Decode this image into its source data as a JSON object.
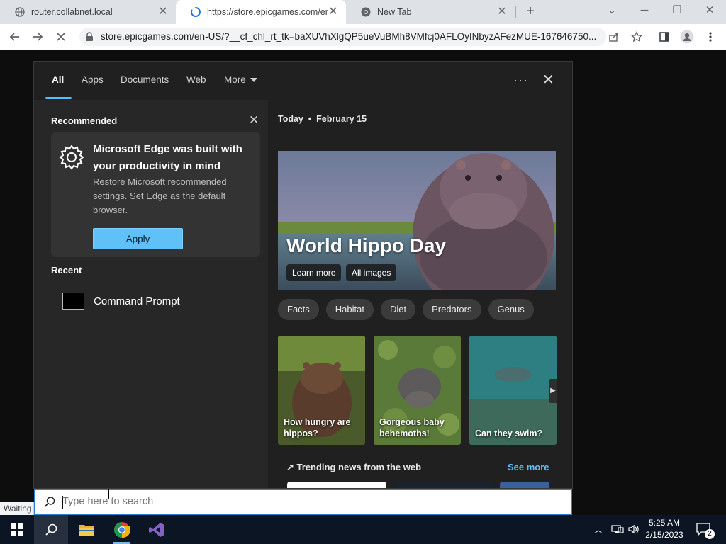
{
  "browser": {
    "tabs": [
      {
        "title": "router.collabnet.local",
        "active": false,
        "icon": "globe-icon"
      },
      {
        "title": "https://store.epicgames.com/en-",
        "active": true,
        "icon": "loading-spinner-icon"
      },
      {
        "title": "New Tab",
        "active": false,
        "icon": "chrome-icon"
      }
    ],
    "new_tab_icon": "plus-icon",
    "address_url": "store.epicgames.com/en-US/?__cf_chl_rt_tk=baXUVhXlgQP5ueVuBMh8VMfcj0AFLOyINbyzAFezMUE-167646750...",
    "status_text": "Waiting"
  },
  "search_panel": {
    "tabs": [
      "All",
      "Apps",
      "Documents",
      "Web",
      "More"
    ],
    "active_tab": "All",
    "recommended": {
      "heading": "Recommended",
      "card_title": "Microsoft Edge was built with your productivity in mind",
      "card_desc": "Restore Microsoft recommended settings. Set Edge as the default browser.",
      "apply_label": "Apply"
    },
    "recent": {
      "heading": "Recent",
      "items": [
        {
          "label": "Command Prompt",
          "icon": "command-prompt-icon"
        }
      ]
    },
    "today": {
      "day_label": "Today",
      "date_label": "February 15",
      "hero_title": "World Hippo Day",
      "hero_buttons": [
        "Learn more",
        "All images"
      ],
      "chips": [
        "Facts",
        "Habitat",
        "Diet",
        "Predators",
        "Genus"
      ],
      "tiles": [
        {
          "caption": "How hungry are hippos?"
        },
        {
          "caption": "Gorgeous baby behemoths!"
        },
        {
          "caption": "Can they swim?"
        }
      ],
      "trending_label": "Trending news from the web",
      "see_more_label": "See more"
    },
    "search_placeholder": "Type here to search"
  },
  "taskbar": {
    "time": "5:25 AM",
    "date": "2/15/2023",
    "notification_count": "2"
  },
  "colors": {
    "accent": "#60c0f8",
    "panel_bg": "#202020",
    "taskbar_bg": "#0b1524"
  }
}
